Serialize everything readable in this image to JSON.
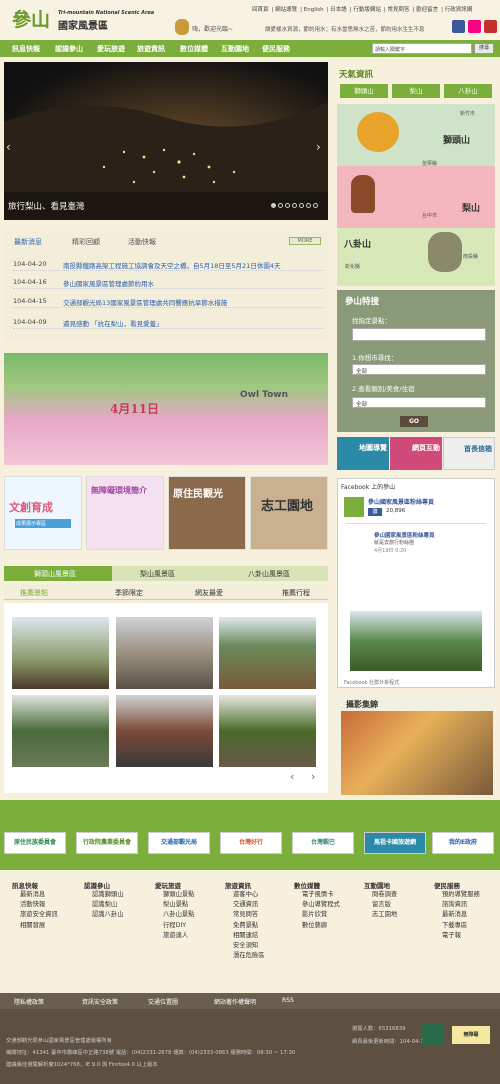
{
  "header": {
    "logo_mark": "參山",
    "logo_en": "Tri-mountain National Scenic Area",
    "logo_cn": "國家風景區",
    "greeting": "嗨，歡迎光臨~",
    "toplinks": [
      "回首頁",
      "網站導覽",
      "English",
      "日本語",
      "行動版網站",
      "常見問答",
      "歡迎留言",
      "行政資訊網"
    ],
    "slogan": "讓愛樣水資源，節約用水；有水當思無水之苦，節約用水生生不息",
    "search_placeholder": "請輸入關鍵字",
    "search_label": "搜尋"
  },
  "nav": [
    "認識參山",
    "愛玩旅遊",
    "旅遊資訊",
    "數位媒體",
    "互動園地",
    "便民服務",
    "訊息快報"
  ],
  "hero": {
    "caption": "旅行梨山、看見臺灣",
    "dots": 7
  },
  "news": {
    "tabs": [
      "最新消息",
      "精彩回顧",
      "活動快報"
    ],
    "more": "MORE",
    "items": [
      {
        "date": "104-04-20",
        "title": "南投縣鐵路高架工程施工協調會及天空之橋，自5月18日至5月21日休園4天"
      },
      {
        "date": "104-04-16",
        "title": "參山國家風景區管理處節約用水"
      },
      {
        "date": "104-04-15",
        "title": "交通部觀光局13國家風景區管理處共同響應抗旱節水措施"
      },
      {
        "date": "104-04-09",
        "title": "邁見感動 「抗在梨山，看見愛蓋」"
      }
    ]
  },
  "banner": {
    "date": "4月11日",
    "title": "Owl Town"
  },
  "tiles": [
    {
      "label": "文創育成",
      "sub": "成果展示專區"
    },
    {
      "label": "無障礙環境簡介"
    },
    {
      "label": "原住民觀光"
    },
    {
      "label": "志工園地"
    }
  ],
  "regions": {
    "tabs": [
      "獅頭山風景區",
      "梨山風景區",
      "八卦山風景區"
    ],
    "subtabs": [
      "推薦景點",
      "季節限定",
      "網友最愛",
      "推薦行程"
    ]
  },
  "weather": {
    "title": "天氣資訊",
    "tabs": [
      "獅頭山",
      "梨山",
      "八卦山"
    ],
    "labels": [
      "獅頭山",
      "梨山",
      "八卦山"
    ],
    "cities": [
      "新竹市",
      "苗栗縣",
      "台中市",
      "彰化縣",
      "南投縣"
    ]
  },
  "tech": {
    "title": "參山特搜",
    "find_label": "找指定景點：",
    "step1": "1.你想市尋找：",
    "step2": "2.查看類別/美食/住宿",
    "select1": "全部",
    "select2": "全部",
    "go": "GO"
  },
  "quick": [
    "地圖導覽",
    "網頁互動",
    "首長信箱"
  ],
  "facebook": {
    "header": "Facebook 上的參山",
    "page": "參山國家風景區粉絲專頁",
    "likes": "20,896",
    "post_title": "參山國家風景區粉絲專頁",
    "post_sub": "就是去旅行粉絲團",
    "date": "4月19日 0:20",
    "plugin": "Facebook 社群外掛程式",
    "like_btn": "讚"
  },
  "ff": {
    "title": "攝影集錦"
  },
  "partners": [
    "原住民族委員會",
    "行政院農業委員會",
    "交通部觀光局",
    "台灣好行",
    "台灣觀巴",
    "馬祖卡國旅遊網",
    "我的E政府"
  ],
  "footer_links": [
    {
      "head": "訊息快報",
      "items": [
        "最新消息",
        "活動快報",
        "旅遊安全資訊",
        "相關發展"
      ]
    },
    {
      "head": "認識參山",
      "items": [
        "認識獅頭山",
        "認識梨山",
        "認識八卦山"
      ]
    },
    {
      "head": "愛玩旅遊",
      "items": [
        "獅頭山景點",
        "梨山景點",
        "八卦山景點",
        "行程DIY",
        "旅遊達人"
      ]
    },
    {
      "head": "旅遊資訊",
      "items": [
        "遊客中心",
        "交通資訊",
        "常見問答",
        "免費景點",
        "相關連結",
        "安全須知",
        "潛在危險區"
      ]
    },
    {
      "head": "數位媒體",
      "items": [
        "電子風情卡",
        "參山導覽程式",
        "影片欣賞",
        "數位藝廊"
      ]
    },
    {
      "head": "互動園地",
      "items": [
        "問卷調查",
        "留言版",
        "志工園地"
      ]
    },
    {
      "head": "便民服務",
      "items": [
        "預約導覽服務",
        "諮詢資訊",
        "最新消息",
        "下載專區",
        "電子報"
      ]
    }
  ],
  "bar": [
    "隱私權政策",
    "資訊安全政策",
    "交通位置圖",
    "網站著作權聲明",
    "RSS"
  ],
  "foot": {
    "copyright": "交通部觀光局參山國家風景區管理處版權所有",
    "address": "機關地址：41341 臺中市霧峰區中正路738號 電話：(04)2331-2678 傳真：(04)2333-0863 服務時間：08:30 ~ 17:30",
    "browser": "建議最佳瀏覽解析度1024*768，IE 9.0 與 Firefox4.0 以上版本",
    "visits": "瀏覽人數：65316839",
    "updated": "網頁最後更新時間：104-04-17",
    "badge": "無障礙"
  }
}
